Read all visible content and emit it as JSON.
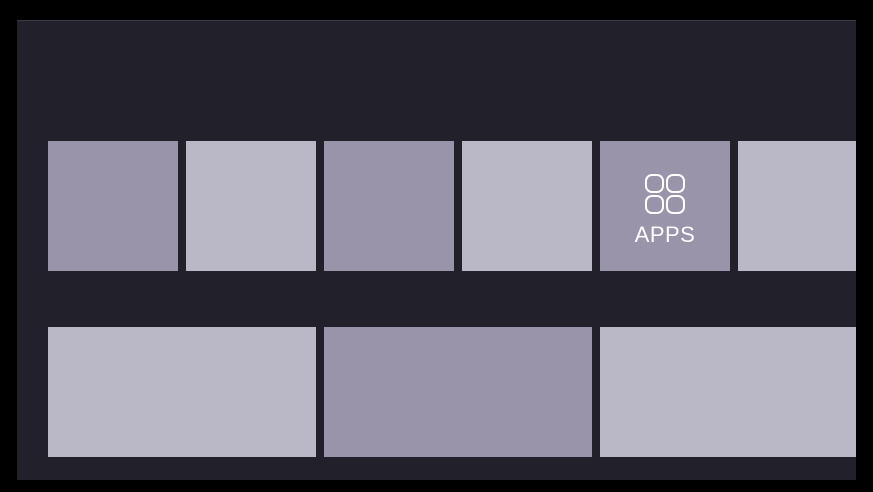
{
  "launcher": {
    "row1": [
      {
        "id": "tile-1",
        "shade": "dark"
      },
      {
        "id": "tile-2",
        "shade": "light"
      },
      {
        "id": "tile-3",
        "shade": "dark"
      },
      {
        "id": "tile-4",
        "shade": "light"
      },
      {
        "id": "apps",
        "shade": "dark",
        "label": "APPS",
        "icon": "apps-grid-icon"
      },
      {
        "id": "tile-6",
        "shade": "light"
      }
    ],
    "row2": [
      {
        "id": "tile-7",
        "shade": "light"
      },
      {
        "id": "tile-8",
        "shade": "dark"
      },
      {
        "id": "tile-9",
        "shade": "light"
      }
    ]
  },
  "colors": {
    "background": "#000000",
    "screen": "#22212b",
    "tile_dark": "#9994aa",
    "tile_light": "#bab7c6",
    "label": "#ffffff"
  }
}
